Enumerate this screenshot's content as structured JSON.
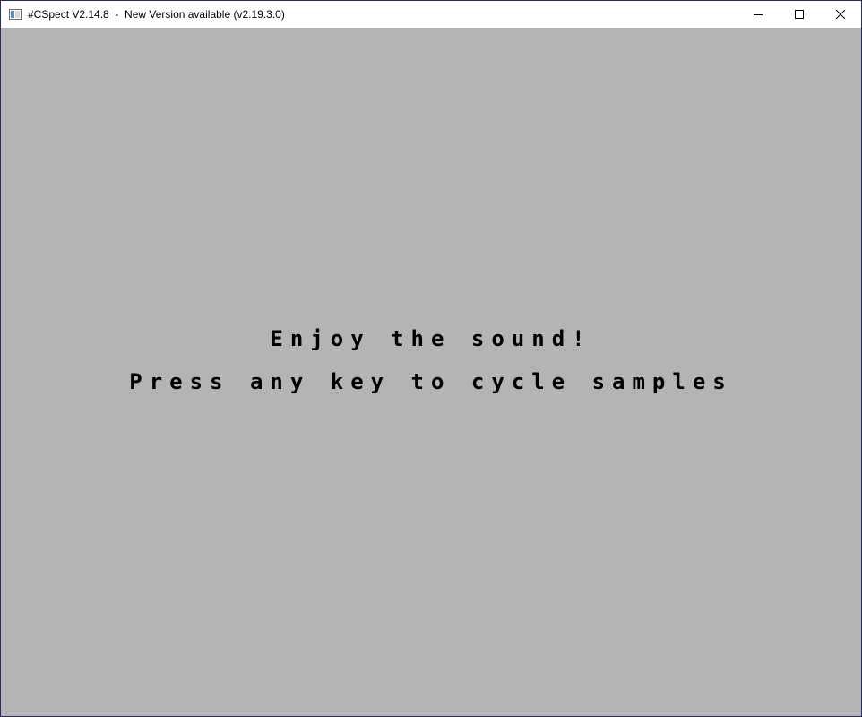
{
  "window": {
    "title": "#CSpect V2.14.8  -  New Version available (v2.19.3.0)",
    "icon": "app-window-icon",
    "buttons": {
      "minimize": "minimize-icon",
      "maximize": "maximize-icon",
      "close": "close-icon"
    }
  },
  "screen": {
    "background": "#b4b4b4",
    "text_color": "#000000",
    "line1": "Enjoy the sound!",
    "line2": "Press any key to cycle samples"
  }
}
